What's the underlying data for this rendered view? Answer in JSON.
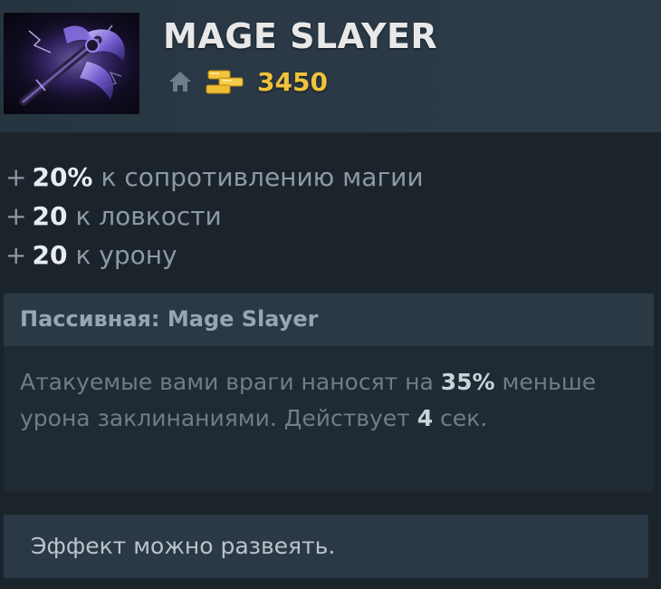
{
  "item": {
    "icon": "mage-slayer-icon",
    "name": "MAGE SLAYER",
    "cost": "3450",
    "home_icon": "home-icon",
    "gold_icon": "gold-icon",
    "accent_color": "#f0c23c"
  },
  "stats": [
    {
      "value": "20%",
      "text": "к сопротивлению магии"
    },
    {
      "value": "20",
      "text": "к ловкости"
    },
    {
      "value": "20",
      "text": "к урону"
    }
  ],
  "stat_prefix": "+",
  "ability": {
    "title": "Пассивная: Mage Slayer",
    "desc_part1": "Атакуемые вами враги наносят на ",
    "desc_value1": "35%",
    "desc_part2": " меньше урона заклинаниями. Действует ",
    "desc_value2": "4",
    "desc_part3": " сек."
  },
  "note": "Эффект можно развеять."
}
